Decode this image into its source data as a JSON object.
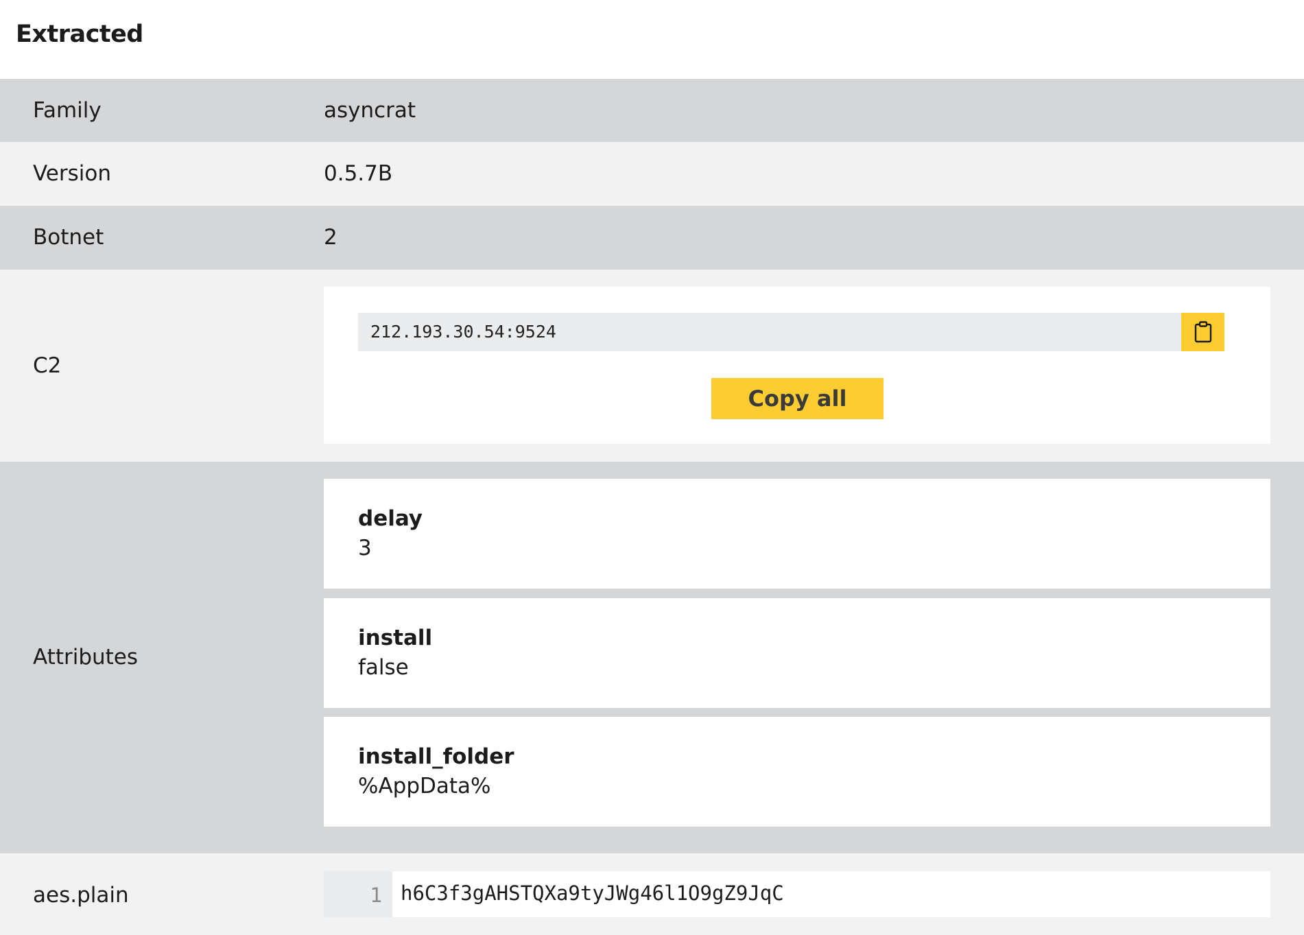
{
  "header": {
    "title": "Extracted"
  },
  "rows": {
    "family": {
      "key": "Family",
      "value": "asyncrat"
    },
    "version": {
      "key": "Version",
      "value": "0.5.7B"
    },
    "botnet": {
      "key": "Botnet",
      "value": "2"
    },
    "c2": {
      "key": "C2",
      "entries": [
        "212.193.30.54:9524"
      ],
      "copy_icon": "clipboard-icon",
      "copy_all_label": "Copy all"
    },
    "attributes": {
      "key": "Attributes",
      "items": [
        {
          "name": "delay",
          "value": "3"
        },
        {
          "name": "install",
          "value": "false"
        },
        {
          "name": "install_folder",
          "value": "%AppData%"
        }
      ]
    },
    "aes_plain": {
      "key": "aes.plain",
      "line_number": "1",
      "code": "h6C3f3gAHSTQXa9tyJWg46l1O9gZ9JqC"
    }
  },
  "colors": {
    "row_dark": "#d5d6d8",
    "row_light": "#f2f2f2",
    "accent_yellow": "#fccd32",
    "field_gray": "#ebeced"
  }
}
